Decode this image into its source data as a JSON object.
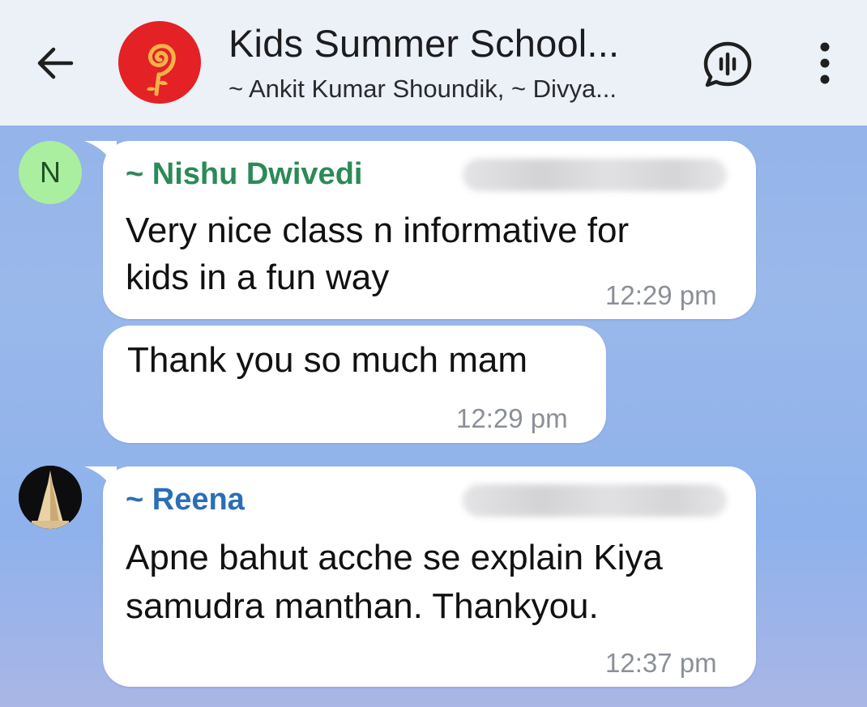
{
  "header": {
    "title": "Kids Summer School...",
    "subtitle": "~ Ankit Kumar Shoundik, ~ Divya...",
    "back_icon": "arrow-left-icon",
    "voice_icon": "voice-chat-icon",
    "menu_icon": "more-vertical-icon",
    "avatar_color": "#e42124"
  },
  "messages": [
    {
      "sender": "~ Nishu Dwivedi",
      "sender_color": "#2b8a57",
      "avatar_letter": "N",
      "avatar_color": "#a9ef9f",
      "text_line1": "Very nice class n informative for",
      "text_line2": "kids in a fun way",
      "time": "12:29 pm"
    },
    {
      "text": "Thank you so much mam",
      "time": "12:29 pm"
    },
    {
      "sender": "~ Reena",
      "sender_color": "#2a6fb5",
      "text_line1": "Apne bahut acche se explain Kiya",
      "text_line2": "samudra manthan. Thankyou.",
      "time": "12:37 pm"
    }
  ]
}
